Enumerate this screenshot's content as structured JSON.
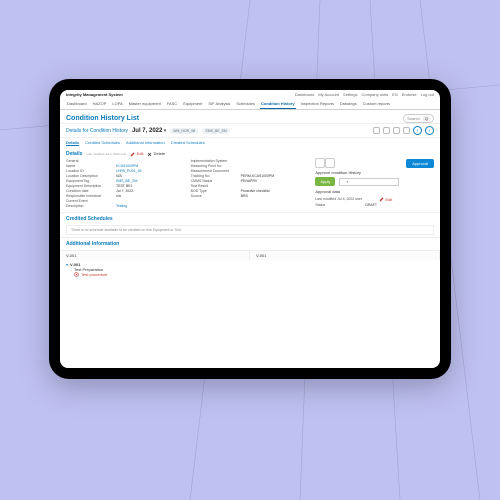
{
  "app": {
    "title": "Integrity Management System"
  },
  "top_links": [
    "Dashboard",
    "My Account",
    "Settings",
    "Company units",
    "EN",
    "Endorse",
    "Log out"
  ],
  "nav": {
    "tabs": [
      "Dashboard",
      "HAZOP",
      "LOPA",
      "Master equipment",
      "FASC",
      "Equipment",
      "SIF Analysis",
      "Schedules",
      "Condition History",
      "Inspection Reports",
      "Drawings",
      "Custom reports"
    ],
    "active_index": 8
  },
  "page": {
    "title": "Condition History List",
    "search_placeholder": "Search",
    "q": "Q"
  },
  "detail": {
    "label": "Details for Condition History",
    "date": "Jul 7, 2022",
    "badges": [
      "WM_HOR_WI",
      "SMS_BE_SM"
    ]
  },
  "subtabs": {
    "items": [
      "Details",
      "Credited Schedules",
      "Additional Information",
      "Created Schedules"
    ],
    "active_index": 0
  },
  "details_section": {
    "heading": "Details",
    "meta": "Last modified Jul 4, 2022 user",
    "edit": "Edit",
    "delete": "Delete"
  },
  "col1": {
    "general": {
      "k": "General",
      "v": ""
    },
    "name": {
      "k": "Name",
      "v": "KCA91000PM"
    },
    "location_id": {
      "k": "Location ID",
      "v": "LHR5_PU01_49"
    },
    "location_desc": {
      "k": "Location Description",
      "v": "N/A"
    },
    "eq_tag": {
      "k": "Equipment Tag",
      "v": "SMS_BE_SM"
    },
    "eq_desc": {
      "k": "Equipment Description",
      "v": "TEST BE1"
    },
    "cond_date": {
      "k": "Condition date",
      "v": "Jul 7, 2022"
    },
    "resp": {
      "k": "Responsible Individual",
      "v": "n/a"
    },
    "current_event": {
      "k": "Current Event",
      "v": ""
    },
    "description": {
      "k": "Description",
      "v": "Testing"
    }
  },
  "col2": {
    "impl_sys": {
      "k": "Implementation System",
      "v": ""
    },
    "meas_point_no": {
      "k": "Measuring Point No",
      "v": ""
    },
    "meas_doc": {
      "k": "Measurement Document",
      "v": ""
    },
    "tracking_no": {
      "k": "Tracking No",
      "v": "PERM-KCA91000PM"
    },
    "cmms": {
      "k": "CMMS Status",
      "v": "PENAPRV"
    },
    "test_result": {
      "k": "Test Result",
      "v": ""
    },
    "bod_type": {
      "k": "BOD Type",
      "v": "Proactive checklist"
    },
    "source": {
      "k": "Source",
      "v": "BRS"
    }
  },
  "col3": {
    "approval_btn": "Approval",
    "panel1_title": "Approve condition History",
    "apply_btn": "Apply",
    "panel2_title": "Approval data",
    "mod_label": "Last modified Jul 4, 2022 user",
    "edit": "Edit",
    "status_k": "Status",
    "status_v": "DRAFT"
  },
  "credited": {
    "heading": "Credited Schedules",
    "note": "There is no schedule available to be credited on this Equipment or Tool."
  },
  "addl": {
    "heading": "Additional Information",
    "col_a": "V-001",
    "col_b": "V-001",
    "tree_root": "V-001",
    "tree_child": "Test Preparation",
    "task": "Test procedure"
  }
}
